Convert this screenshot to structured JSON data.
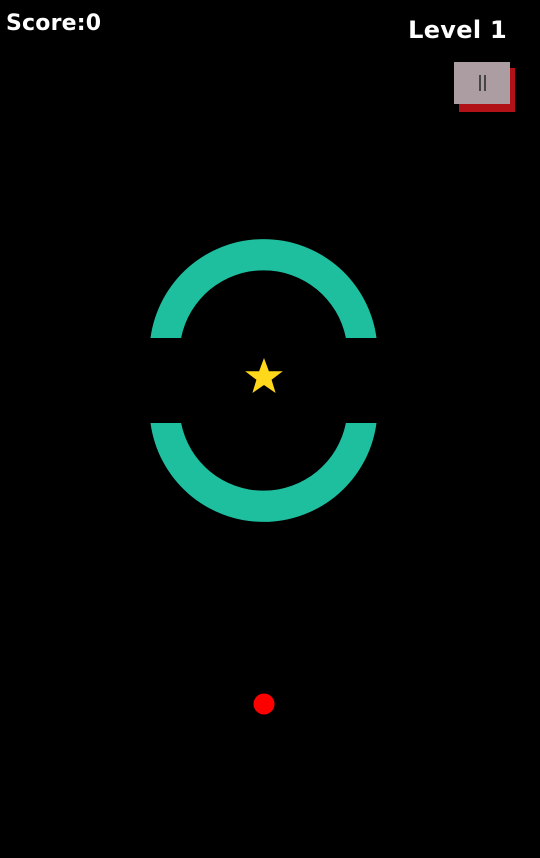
{
  "hud": {
    "score_label": "Score:0",
    "level_label": "Level 1"
  },
  "pause_button": {
    "icon": "pause-icon"
  },
  "game": {
    "ring_color": "#1dbf9f",
    "star_color": "#ffd71b",
    "ball_color": "#ff0000",
    "background_color": "#000000",
    "pause_face_color": "#ab9da2",
    "pause_shadow_color": "#b01217",
    "objects": [
      "rotating-ring",
      "star",
      "player-ball"
    ]
  }
}
